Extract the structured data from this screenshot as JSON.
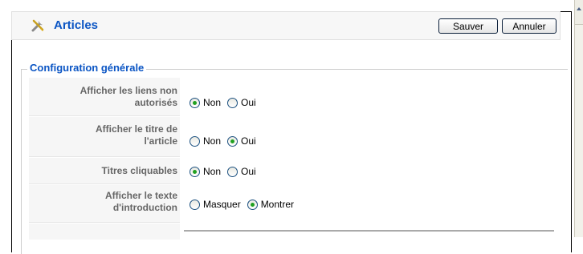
{
  "header": {
    "title": "Articles",
    "icon": "tools-icon",
    "save_label": "Sauver",
    "cancel_label": "Annuler"
  },
  "section": {
    "legend": "Configuration générale"
  },
  "settings": [
    {
      "label_line1": "Afficher les liens non",
      "label_line2": "autorisés",
      "options": [
        {
          "label": "Non",
          "checked": true
        },
        {
          "label": "Oui",
          "checked": false
        }
      ]
    },
    {
      "label_line1": "Afficher le titre de",
      "label_line2": "l'article",
      "options": [
        {
          "label": "Non",
          "checked": false
        },
        {
          "label": "Oui",
          "checked": true
        }
      ]
    },
    {
      "label_line1": "Titres cliquables",
      "label_line2": "",
      "options": [
        {
          "label": "Non",
          "checked": true
        },
        {
          "label": "Oui",
          "checked": false
        }
      ]
    },
    {
      "label_line1": "Afficher le texte",
      "label_line2": "d'introduction",
      "options": [
        {
          "label": "Masquer",
          "checked": false
        },
        {
          "label": "Montrer",
          "checked": true
        }
      ]
    }
  ],
  "colors": {
    "accent": "#0b55c4",
    "label_text": "#666666",
    "radio_check": "#21a121"
  }
}
